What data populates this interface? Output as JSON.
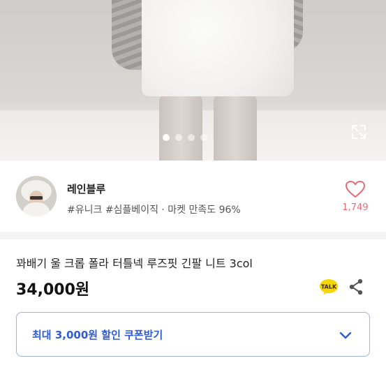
{
  "carousel": {
    "slide_count": 4,
    "active_index": 0
  },
  "seller": {
    "name": "레인블루",
    "tags": "#유니크 #심플베이직 · 마켓 만족도 96%",
    "likes": "1,749"
  },
  "product": {
    "title": "꽈배기 울 크롭 폴라 터틀넥 루즈핏 긴팔 니트 3col",
    "price": "34,000원"
  },
  "coupon": {
    "label": "최대 3,000원 할인 쿠폰받기"
  },
  "icons": {
    "expand": "expand-icon",
    "heart": "heart-icon",
    "talk": "kakao-talk-icon",
    "share": "share-icon",
    "chevron": "chevron-down-icon"
  },
  "colors": {
    "accent_blue": "#2f5bd8",
    "like_pink": "#e86a78",
    "talk_yellow": "#f5d600"
  }
}
